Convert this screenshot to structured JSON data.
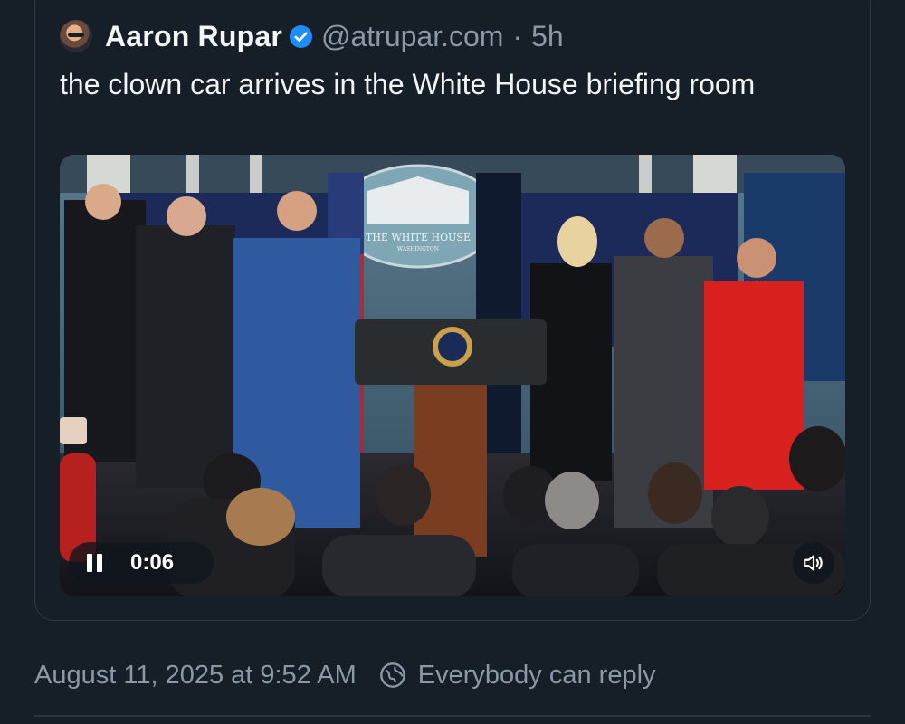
{
  "post": {
    "author": {
      "display_name": "Aaron Rupar",
      "handle": "@atrupar.com",
      "verified": true
    },
    "separator": "·",
    "age": "5h",
    "text": "the clown car arrives in the White House briefing room",
    "video": {
      "elapsed": "0:06",
      "state": "playing",
      "podium_seal_text": "THE WHITE HOUSE",
      "podium_seal_subtext": "WASHINGTON"
    },
    "timestamp": "August 11, 2025 at 9:52 AM",
    "reply_setting": "Everybody can reply"
  },
  "colors": {
    "background": "#161e27",
    "text_primary": "#f1f3f5",
    "text_secondary": "#8b98a6",
    "verified_blue": "#1d8cf8",
    "border": "#2e3a47"
  },
  "icons": {
    "verified": "verified-badge-icon",
    "pause": "pause-icon",
    "volume": "volume-icon",
    "reply": "globe-reply-icon"
  }
}
